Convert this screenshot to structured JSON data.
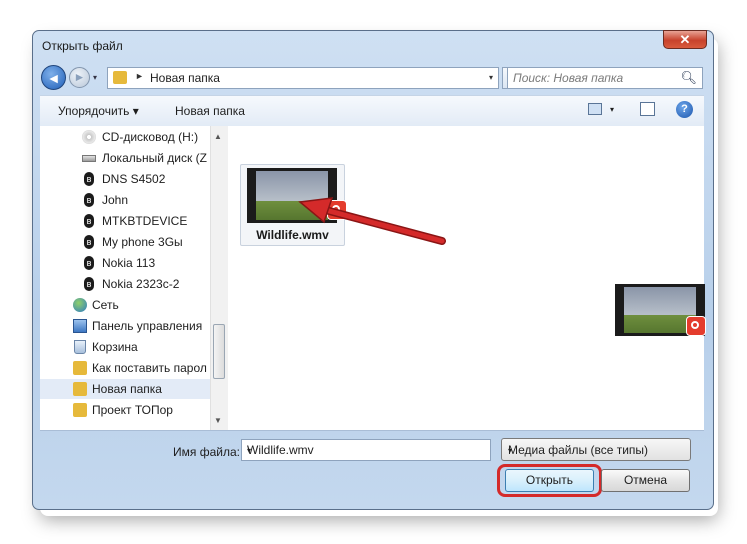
{
  "window": {
    "title": "Открыть файл",
    "close_label": "✕"
  },
  "nav": {
    "back": "◄",
    "forward": "►",
    "history": "▾"
  },
  "address": {
    "path": "Новая папка",
    "separator": "►",
    "dropdown": "▾"
  },
  "refresh": "↻",
  "search": {
    "placeholder": "Поиск: Новая папка",
    "icon": "search-icon"
  },
  "toolbar": {
    "organize_label": "Упорядочить ▾",
    "new_folder_label": "Новая папка",
    "view_dd": "▾",
    "help": "?"
  },
  "sidebar": {
    "items": [
      {
        "label": "CD-дисковод (H:)",
        "icon": "cd-drive-icon"
      },
      {
        "label": "Локальный диск (Z",
        "icon": "local-disk-icon"
      },
      {
        "label": "DNS S4502",
        "icon": "bluetooth-icon"
      },
      {
        "label": "John",
        "icon": "bluetooth-icon"
      },
      {
        "label": "MTKBTDEVICE",
        "icon": "bluetooth-icon"
      },
      {
        "label": "My phone 3Gы",
        "icon": "bluetooth-icon"
      },
      {
        "label": "Nokia 113",
        "icon": "bluetooth-icon"
      },
      {
        "label": "Nokia 2323c-2",
        "icon": "bluetooth-icon"
      },
      {
        "label": "Сеть",
        "icon": "network-icon"
      },
      {
        "label": "Панель управления",
        "icon": "control-panel-icon"
      },
      {
        "label": "Корзина",
        "icon": "recycle-bin-icon"
      },
      {
        "label": "Как поставить парол",
        "icon": "folder-icon"
      },
      {
        "label": "Новая папка",
        "icon": "folder-icon",
        "selected": true
      },
      {
        "label": "Проект ТОПор",
        "icon": "folder-icon"
      }
    ],
    "bluetooth_glyph": "ʙ"
  },
  "files": [
    {
      "name": "Wildlife.wmv",
      "icon": "video-thumbnail-icon"
    }
  ],
  "bottom": {
    "filename_label": "Имя файла:",
    "filename_value": "Wildlife.wmv",
    "filter_value": "Медиа файлы (все типы)",
    "dropdown": "▾",
    "open_label": "Открыть",
    "cancel_label": "Отмена"
  },
  "colors": {
    "highlight": "#d42a2a",
    "folder": "#e6b93b",
    "window_frame": "#b7cfea"
  }
}
